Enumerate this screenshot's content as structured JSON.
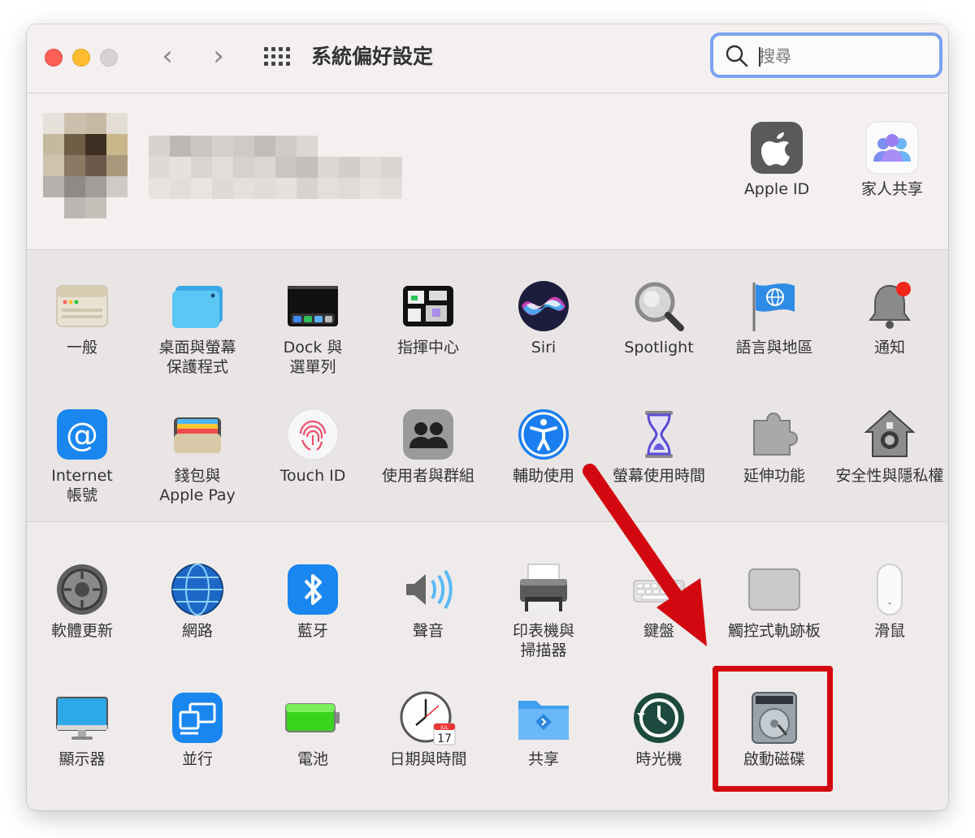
{
  "window": {
    "title": "系統偏好設定",
    "back_glyph": "‹",
    "forward_glyph": "›"
  },
  "search": {
    "placeholder": "搜尋",
    "value": ""
  },
  "account": {
    "items": [
      {
        "label": "Apple ID",
        "icon": "apple-logo-icon"
      },
      {
        "label": "家人共享",
        "icon": "family-sharing-icon"
      }
    ]
  },
  "section1": {
    "items": [
      {
        "label": "一般",
        "icon": "general-icon"
      },
      {
        "label": "桌面與螢幕\n保護程式",
        "icon": "desktop-screensaver-icon"
      },
      {
        "label": "Dock 與\n選單列",
        "icon": "dock-menubar-icon"
      },
      {
        "label": "指揮中心",
        "icon": "mission-control-icon"
      },
      {
        "label": "Siri",
        "icon": "siri-icon"
      },
      {
        "label": "Spotlight",
        "icon": "spotlight-icon"
      },
      {
        "label": "語言與地區",
        "icon": "language-region-icon"
      },
      {
        "label": "通知",
        "icon": "notifications-icon"
      },
      {
        "label": "Internet\n帳號",
        "icon": "internet-accounts-icon"
      },
      {
        "label": "錢包與\nApple Pay",
        "icon": "wallet-icon"
      },
      {
        "label": "Touch ID",
        "icon": "touch-id-icon"
      },
      {
        "label": "使用者與群組",
        "icon": "users-groups-icon"
      },
      {
        "label": "輔助使用",
        "icon": "accessibility-icon"
      },
      {
        "label": "螢幕使用時間",
        "icon": "screen-time-icon"
      },
      {
        "label": "延伸功能",
        "icon": "extensions-icon"
      },
      {
        "label": "安全性與隱私權",
        "icon": "security-privacy-icon"
      }
    ]
  },
  "section2": {
    "items": [
      {
        "label": "軟體更新",
        "icon": "software-update-icon"
      },
      {
        "label": "網路",
        "icon": "network-icon"
      },
      {
        "label": "藍牙",
        "icon": "bluetooth-icon"
      },
      {
        "label": "聲音",
        "icon": "sound-icon"
      },
      {
        "label": "印表機與\n掃描器",
        "icon": "printer-icon"
      },
      {
        "label": "鍵盤",
        "icon": "keyboard-icon"
      },
      {
        "label": "觸控式軌跡板",
        "icon": "trackpad-icon"
      },
      {
        "label": "滑鼠",
        "icon": "mouse-icon"
      },
      {
        "label": "顯示器",
        "icon": "displays-icon"
      },
      {
        "label": "並行",
        "icon": "sidecar-icon"
      },
      {
        "label": "電池",
        "icon": "battery-icon"
      },
      {
        "label": "日期與時間",
        "icon": "date-time-icon"
      },
      {
        "label": "共享",
        "icon": "sharing-icon"
      },
      {
        "label": "時光機",
        "icon": "time-machine-icon"
      },
      {
        "label": "啟動磁碟",
        "icon": "startup-disk-icon"
      }
    ]
  },
  "calendar_icon": {
    "month": "JUL",
    "day": "17"
  },
  "colors": {
    "highlight": "#d3070f",
    "arrow": "#d3070f",
    "search_focus": "#7aa2f2"
  }
}
